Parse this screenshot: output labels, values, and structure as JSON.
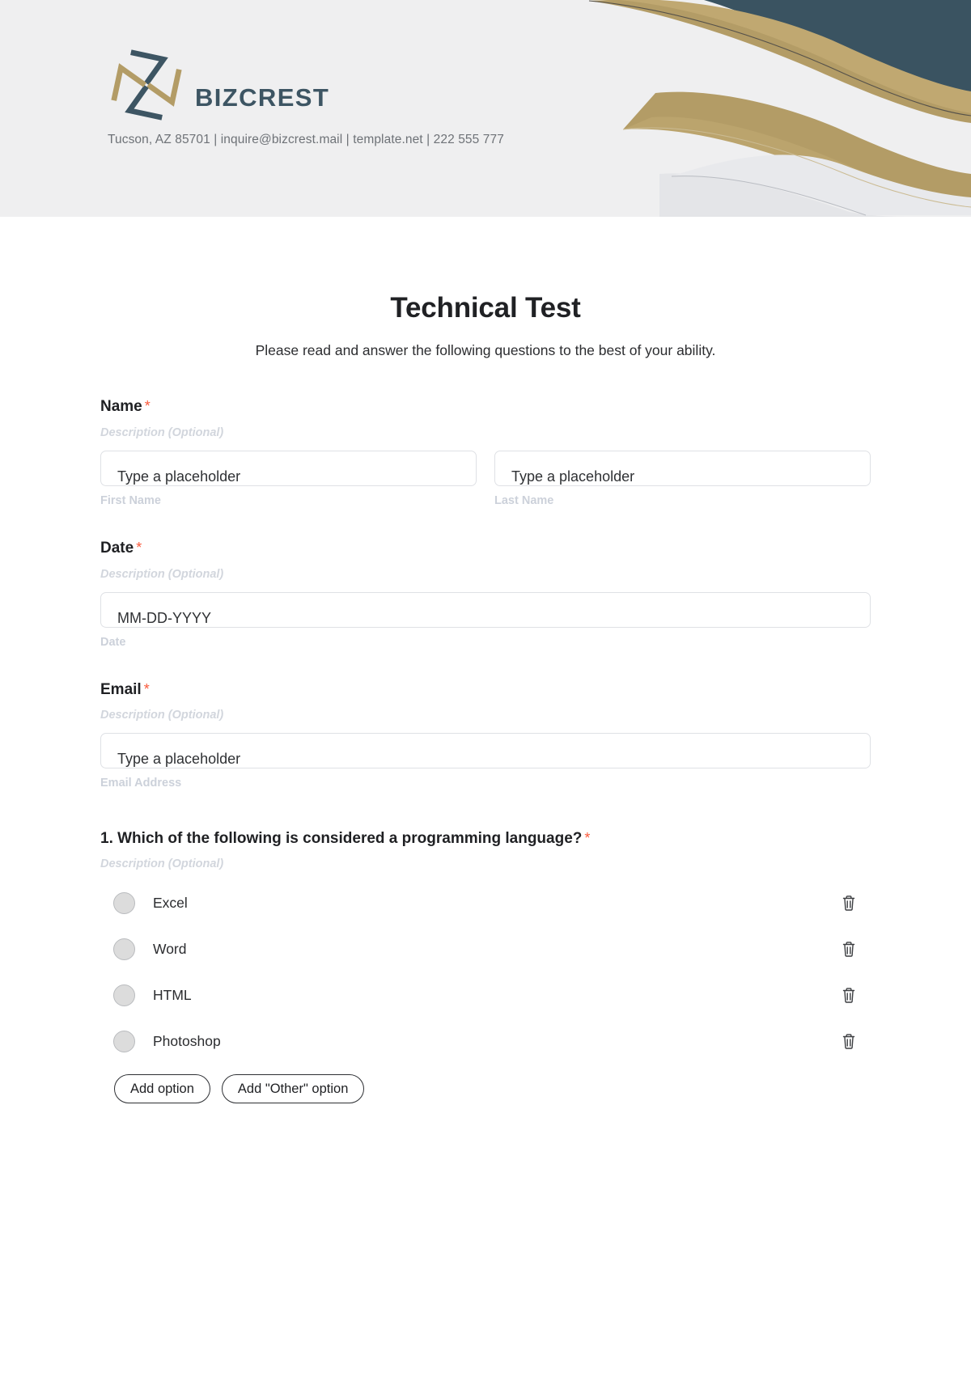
{
  "letterhead": {
    "brand_name": "BIZCREST",
    "contact_line": "Tucson, AZ 85701 | inquire@bizcrest.mail | template.net | 222 555 777",
    "colors": {
      "band_bg": "#efeff0",
      "dark_teal": "#3a5361",
      "gold": "#bfa871",
      "gold_dark": "#a8925f",
      "pale_gray": "#e4e5e8",
      "brand_text": "#3d5563",
      "contact_text": "#6e7277"
    }
  },
  "form": {
    "title": "Technical Test",
    "subtitle": "Please read and answer the following questions to the best of your ability.",
    "required_marker": "*",
    "description_placeholder": "Description (Optional)",
    "fields": [
      {
        "label": "Name",
        "description": "Description (Optional)",
        "inputs": [
          {
            "value": "Type a placeholder",
            "sub_label": "First Name"
          },
          {
            "value": "Type a placeholder",
            "sub_label": "Last Name"
          }
        ]
      },
      {
        "label": "Date",
        "description": "Description (Optional)",
        "inputs": [
          {
            "value": "MM-DD-YYYY",
            "sub_label": "Date"
          }
        ]
      },
      {
        "label": "Email",
        "description": "Description (Optional)",
        "inputs": [
          {
            "value": "Type a placeholder",
            "sub_label": "Email Address"
          }
        ]
      }
    ],
    "question": {
      "label": "1. Which of the following is considered a programming language?",
      "description": "Description (Optional)",
      "options": [
        {
          "text": "Excel"
        },
        {
          "text": "Word"
        },
        {
          "text": "HTML"
        },
        {
          "text": "Photoshop"
        }
      ],
      "add_option_label": "Add option",
      "add_other_option_label": "Add \"Other\" option",
      "delete_icon": "trash-icon",
      "required_marker": "*"
    }
  }
}
